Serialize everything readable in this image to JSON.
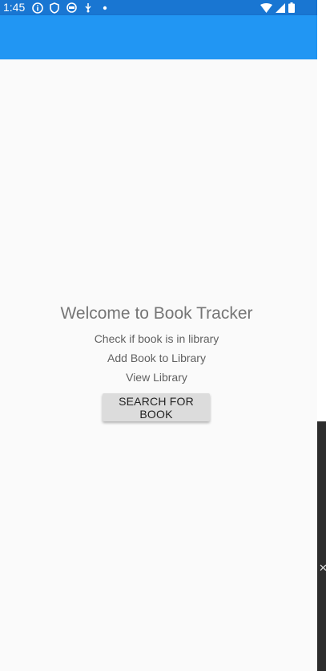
{
  "status_bar": {
    "time": "1:45",
    "left_icons": [
      "info-icon",
      "shield-icon",
      "db-icon",
      "usb-icon",
      "dot-icon"
    ],
    "right_icons": [
      "wifi-icon",
      "signal-icon",
      "battery-icon"
    ]
  },
  "app_bar": {
    "color": "#2196f3"
  },
  "main": {
    "title": "Welcome to Book Tracker",
    "items": [
      {
        "label": "Check if book is in library"
      },
      {
        "label": "Add Book to Library"
      },
      {
        "label": "View Library"
      }
    ],
    "button_label": "SEARCH FOR BOOK"
  },
  "colors": {
    "status_bar": "#1976d2",
    "app_bar": "#2196f3",
    "background": "#fafafa",
    "button": "#dcdcdc"
  }
}
